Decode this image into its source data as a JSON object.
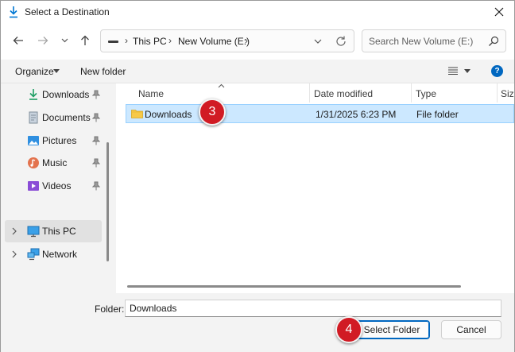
{
  "window": {
    "title": "Select a Destination"
  },
  "address": {
    "crumbs": [
      "This PC",
      "New Volume (E:)"
    ]
  },
  "search": {
    "placeholder": "Search New Volume (E:)"
  },
  "commands": {
    "organize": "Organize",
    "new_folder": "New folder",
    "help": "?"
  },
  "sidebar": {
    "quick_access": [
      {
        "label": "Downloads",
        "icon": "download-icon"
      },
      {
        "label": "Documents",
        "icon": "document-icon"
      },
      {
        "label": "Pictures",
        "icon": "picture-icon"
      },
      {
        "label": "Music",
        "icon": "music-icon"
      },
      {
        "label": "Videos",
        "icon": "video-icon"
      }
    ],
    "this_pc": "This PC",
    "network": "Network"
  },
  "columns": {
    "name": "Name",
    "date": "Date modified",
    "type": "Type",
    "size": "Size"
  },
  "rows": [
    {
      "name": "Downloads",
      "date": "1/31/2025 6:23 PM",
      "type": "File folder"
    }
  ],
  "markers": {
    "step_a": "3",
    "step_b": "4"
  },
  "footer": {
    "folder_label": "Folder:",
    "folder_value": "Downloads",
    "select_button": "Select Folder",
    "cancel_button": "Cancel"
  },
  "colors": {
    "accent": "#0067c0",
    "selection": "#cce8ff",
    "marker": "#d11b24"
  }
}
